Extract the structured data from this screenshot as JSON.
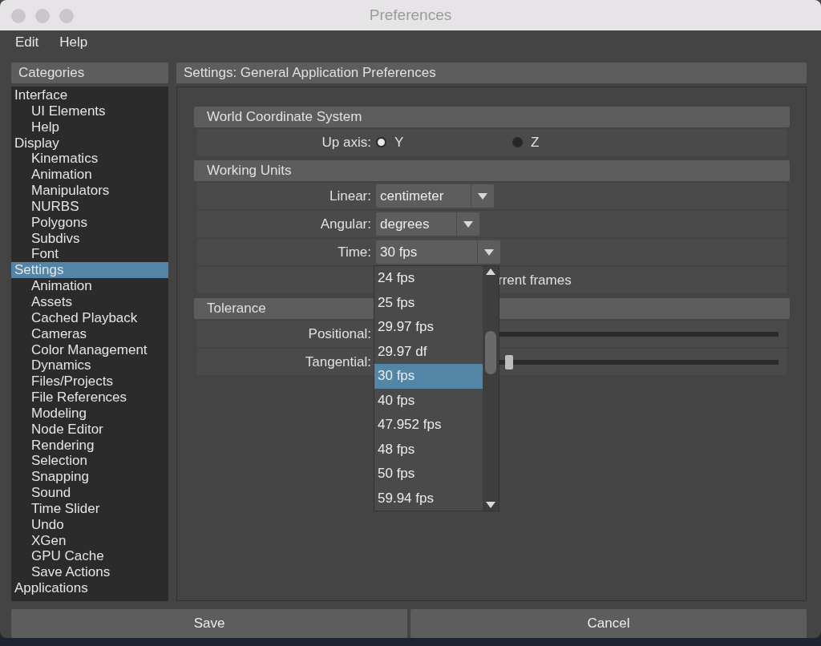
{
  "window": {
    "title": "Preferences"
  },
  "menu": [
    "Edit",
    "Help"
  ],
  "sidebar": {
    "title": "Categories",
    "items": [
      {
        "label": "Interface",
        "selected": false,
        "children": [
          {
            "label": "UI Elements",
            "selected": false
          },
          {
            "label": "Help",
            "selected": false
          }
        ]
      },
      {
        "label": "Display",
        "selected": false,
        "children": [
          {
            "label": "Kinematics",
            "selected": false
          },
          {
            "label": "Animation",
            "selected": false
          },
          {
            "label": "Manipulators",
            "selected": false
          },
          {
            "label": "NURBS",
            "selected": false
          },
          {
            "label": "Polygons",
            "selected": false
          },
          {
            "label": "Subdivs",
            "selected": false
          },
          {
            "label": "Font",
            "selected": false
          }
        ]
      },
      {
        "label": "Settings",
        "selected": true,
        "children": [
          {
            "label": "Animation",
            "selected": false
          },
          {
            "label": "Assets",
            "selected": false
          },
          {
            "label": "Cached Playback",
            "selected": false
          },
          {
            "label": "Cameras",
            "selected": false
          },
          {
            "label": "Color Management",
            "selected": false
          },
          {
            "label": "Dynamics",
            "selected": false
          },
          {
            "label": "Files/Projects",
            "selected": false
          },
          {
            "label": "File References",
            "selected": false
          },
          {
            "label": "Modeling",
            "selected": false
          },
          {
            "label": "Node Editor",
            "selected": false
          },
          {
            "label": "Rendering",
            "selected": false
          },
          {
            "label": "Selection",
            "selected": false
          },
          {
            "label": "Snapping",
            "selected": false
          },
          {
            "label": "Sound",
            "selected": false
          },
          {
            "label": "Time Slider",
            "selected": false
          },
          {
            "label": "Undo",
            "selected": false
          },
          {
            "label": "XGen",
            "selected": false
          },
          {
            "label": "GPU Cache",
            "selected": false
          },
          {
            "label": "Save Actions",
            "selected": false
          }
        ]
      },
      {
        "label": "Applications",
        "selected": false
      }
    ]
  },
  "panel": {
    "title": "Settings: General Application Preferences",
    "sections": [
      {
        "title": "World Coordinate System",
        "rows": [
          {
            "kind": "radio",
            "label": "Up axis:",
            "options": [
              {
                "label": "Y",
                "selected": true
              },
              {
                "label": "Z",
                "selected": false
              }
            ]
          }
        ]
      },
      {
        "title": "Working Units",
        "rows": [
          {
            "kind": "select",
            "label": "Linear:",
            "value": "centimeter",
            "expanded": false
          },
          {
            "kind": "select",
            "label": "Angular:",
            "value": "degrees",
            "expanded": false
          },
          {
            "kind": "select",
            "label": "Time:",
            "value": "30 fps",
            "expanded": true
          },
          {
            "kind": "text",
            "text": "rrent frames"
          }
        ]
      },
      {
        "title": "Tolerance",
        "rows": [
          {
            "kind": "slider",
            "label": "Positional:"
          },
          {
            "kind": "slider",
            "label": "Tangential:",
            "level": 0.33
          }
        ]
      }
    ]
  },
  "dropdown": {
    "options": [
      {
        "label": "24 fps",
        "selected": false
      },
      {
        "label": "25 fps",
        "selected": false
      },
      {
        "label": "29.97 fps",
        "selected": false
      },
      {
        "label": "29.97 df",
        "selected": false
      },
      {
        "label": "30 fps",
        "selected": true
      },
      {
        "label": "40 fps",
        "selected": false
      },
      {
        "label": "47.952 fps",
        "selected": false
      },
      {
        "label": "48 fps",
        "selected": false
      },
      {
        "label": "50 fps",
        "selected": false
      },
      {
        "label": "59.94 fps",
        "selected": false
      }
    ]
  },
  "buttons": [
    "Save",
    "Cancel"
  ]
}
